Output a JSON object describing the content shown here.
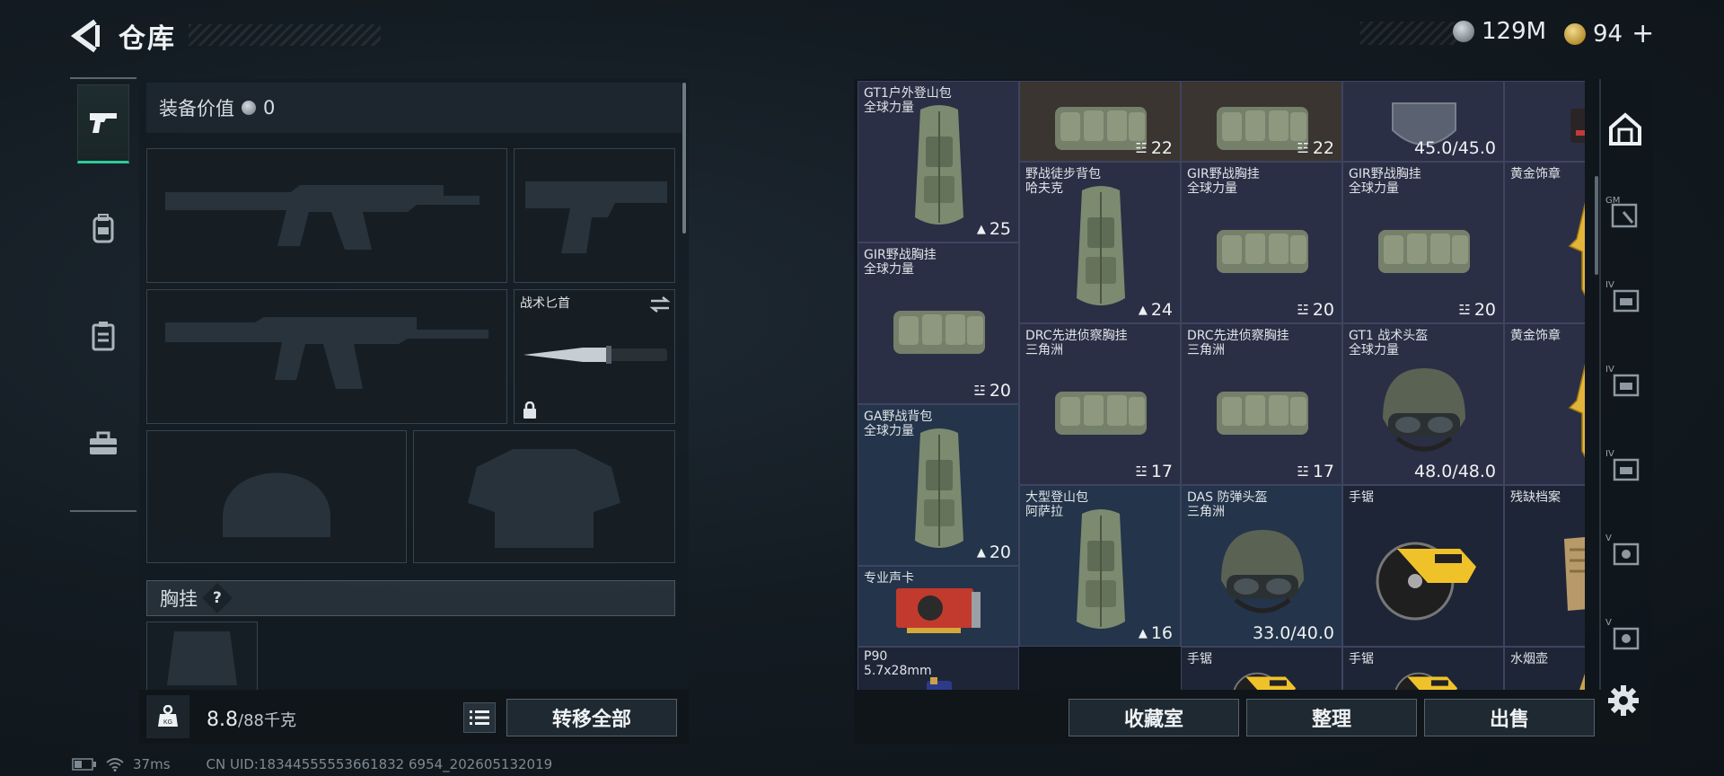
{
  "header": {
    "title": "仓库"
  },
  "currency": [
    {
      "value": "129M",
      "icon": "silver-coin-icon",
      "color": "#9aa4ab"
    },
    {
      "value": "94",
      "icon": "gold-coin-icon",
      "color": "#c9a24a",
      "suffix": "+"
    }
  ],
  "left": {
    "value_label": "装备价值",
    "value_amount": "0",
    "knife_slot_label": "战术匕首",
    "chest_rig_label": "胸挂",
    "chest_rig_help": "?",
    "weight_current": "8.8",
    "weight_capacity": "/88千克",
    "transfer_all_label": "转移全部",
    "tabs": [
      {
        "icon": "pistol-icon",
        "active": true
      },
      {
        "icon": "backpack-icon",
        "active": false
      },
      {
        "icon": "vest-icon",
        "active": false
      },
      {
        "icon": "toolbox-icon",
        "active": false
      }
    ]
  },
  "status": {
    "ping": "37ms",
    "uid": "CN UID:18344555553661832 6954_202605132019"
  },
  "grid": {
    "items": [
      {
        "name": "GT1户外登山包",
        "sub": "全球力量",
        "badge": "25",
        "icon": "backpack-icon"
      },
      {
        "name": "",
        "sub": "",
        "badge": "22",
        "icon": "rig-icon"
      },
      {
        "name": "",
        "sub": "",
        "badge": "22",
        "icon": "rig-icon"
      },
      {
        "name": "",
        "sub": "",
        "badge": "45.0/45.0",
        "icon": "visor-icon"
      },
      {
        "name": "",
        "sub": "",
        "badge": "",
        "icon": "misc-icon"
      },
      {
        "name": "野战徒步背包",
        "sub": "哈夫克",
        "badge": "24",
        "icon": "backpack-icon"
      },
      {
        "name": "GIR野战胸挂",
        "sub": "全球力量",
        "badge": "20",
        "icon": "rig-icon"
      },
      {
        "name": "GIR野战胸挂",
        "sub": "全球力量",
        "badge": "20",
        "icon": "rig-icon"
      },
      {
        "name": "黄金饰章",
        "sub": "",
        "badge": "",
        "icon": "gold-emblem-icon"
      },
      {
        "name": "GIR野战胸挂",
        "sub": "全球力量",
        "badge": "20",
        "icon": "rig-icon"
      },
      {
        "name": "DRC先进侦察胸挂",
        "sub": "三角洲",
        "badge": "17",
        "icon": "rig-icon"
      },
      {
        "name": "DRC先进侦察胸挂",
        "sub": "三角洲",
        "badge": "17",
        "icon": "rig-icon"
      },
      {
        "name": "GT1 战术头盔",
        "sub": "全球力量",
        "badge": "48.0/48.0",
        "icon": "helmet-icon"
      },
      {
        "name": "黄金饰章",
        "sub": "",
        "badge": "",
        "icon": "gold-emblem-icon"
      },
      {
        "name": "GA野战背包",
        "sub": "全球力量",
        "badge": "20",
        "icon": "backpack-icon"
      },
      {
        "name": "大型登山包",
        "sub": "阿萨拉",
        "badge": "16",
        "icon": "backpack-icon"
      },
      {
        "name": "DAS 防弹头盔",
        "sub": "三角洲",
        "badge": "33.0/40.0",
        "icon": "helmet-icon"
      },
      {
        "name": "手锯",
        "sub": "",
        "badge": "",
        "icon": "saw-icon"
      },
      {
        "name": "残缺档案",
        "sub": "",
        "badge": "",
        "icon": "document-icon"
      },
      {
        "name": "专业声卡",
        "sub": "",
        "badge": "",
        "icon": "sound-card-icon"
      },
      {
        "name": "P90",
        "sub": "5.7x28mm",
        "badge": "",
        "icon": "ammo-icon"
      },
      {
        "name": "手锯",
        "sub": "",
        "badge": "",
        "icon": "saw-icon"
      },
      {
        "name": "手锯",
        "sub": "",
        "badge": "",
        "icon": "saw-icon"
      },
      {
        "name": "水烟壶",
        "sub": "",
        "badge": "",
        "icon": "hookah-icon"
      }
    ]
  },
  "sidebar_right": [
    {
      "icon": "safe-box-icon",
      "label": ""
    },
    {
      "icon": "gm-container-icon",
      "label": "GM"
    },
    {
      "icon": "container-iv-icon",
      "label": "IV"
    },
    {
      "icon": "container-iv-icon",
      "label": "IV"
    },
    {
      "icon": "container-iv-icon",
      "label": "IV"
    },
    {
      "icon": "container-v-icon",
      "label": "V"
    },
    {
      "icon": "container-v-icon",
      "label": "V"
    }
  ],
  "footer": {
    "collection_label": "收藏室",
    "sort_label": "整理",
    "sell_label": "出售"
  }
}
